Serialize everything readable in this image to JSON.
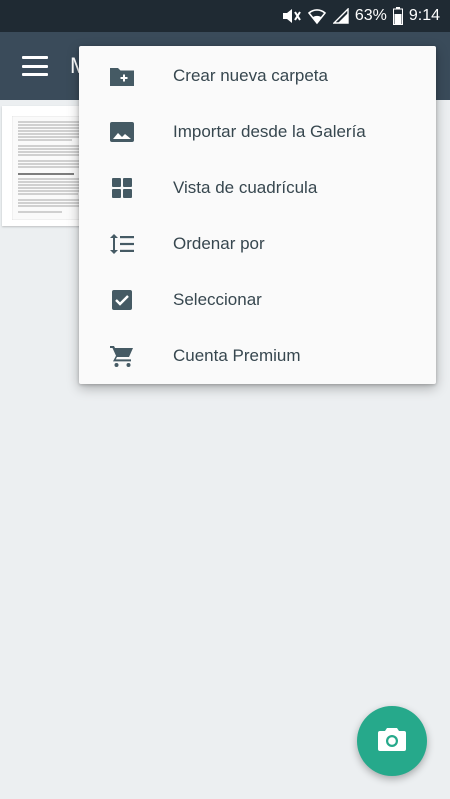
{
  "status_bar": {
    "battery_percent": "63%",
    "time": "9:14"
  },
  "app_bar": {
    "title": "M",
    "menu_icon": "hamburger-icon"
  },
  "menu": {
    "items": [
      {
        "label": "Crear nueva carpeta",
        "icon": "create-folder-icon"
      },
      {
        "label": "Importar desde la Galería",
        "icon": "image-icon"
      },
      {
        "label": "Vista de cuadrícula",
        "icon": "grid-view-icon"
      },
      {
        "label": "Ordenar por",
        "icon": "sort-icon"
      },
      {
        "label": "Seleccionar",
        "icon": "checkbox-icon"
      },
      {
        "label": "Cuenta Premium",
        "icon": "cart-icon"
      }
    ]
  },
  "fab": {
    "icon": "camera-icon"
  },
  "colors": {
    "status_bar": "#1f2a33",
    "app_bar": "#3a4b5a",
    "background": "#eceff1",
    "menu_text": "#37474f",
    "menu_icon": "#455a64",
    "fab": "#26a98b"
  }
}
